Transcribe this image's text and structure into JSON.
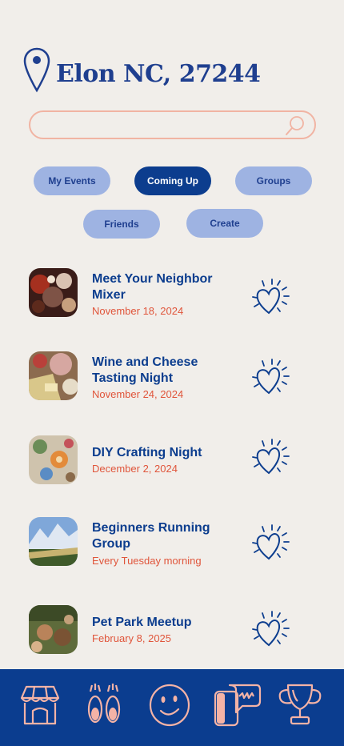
{
  "header": {
    "location": "Elon NC, 27244",
    "pin_icon": "map-pin-icon"
  },
  "search": {
    "value": "",
    "placeholder": "",
    "icon": "search-icon"
  },
  "filters": [
    {
      "label": "My Events",
      "active": false
    },
    {
      "label": "Coming Up",
      "active": true
    },
    {
      "label": "Groups",
      "active": false
    },
    {
      "label": "Friends",
      "active": false
    },
    {
      "label": "Create",
      "active": false
    }
  ],
  "events": [
    {
      "title": "Meet Your Neighbor Mixer",
      "date": "November 18, 2024"
    },
    {
      "title": "Wine and Cheese Tasting Night",
      "date": "November 24, 2024"
    },
    {
      "title": "DIY Crafting Night",
      "date": "December 2, 2024"
    },
    {
      "title": "Beginners Running Group",
      "date": "Every Tuesday morning"
    },
    {
      "title": "Pet Park Meetup",
      "date": "February 8, 2025"
    }
  ],
  "nav": [
    {
      "icon": "storefront-icon"
    },
    {
      "icon": "footprints-icon"
    },
    {
      "icon": "smiley-face-icon"
    },
    {
      "icon": "phone-chat-icon"
    },
    {
      "icon": "trophy-icon"
    }
  ],
  "colors": {
    "background": "#f1eeea",
    "primary": "#0c3d8e",
    "pill": "#9eb3e2",
    "accent": "#e0553b",
    "search_border": "#f1b4a3",
    "nav_icon": "#f4b3a6"
  }
}
